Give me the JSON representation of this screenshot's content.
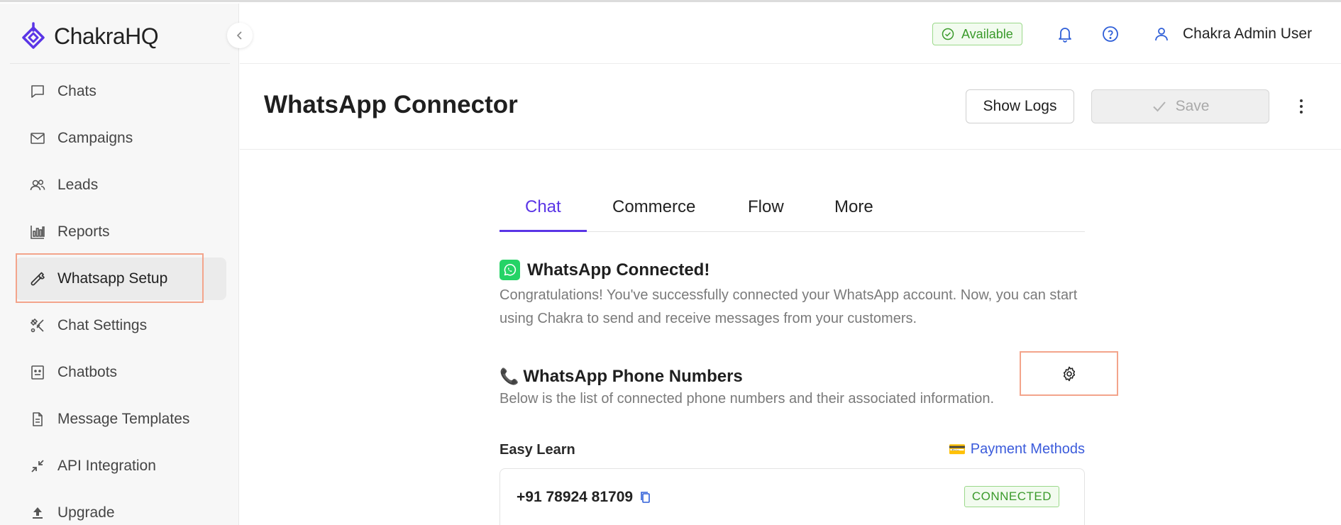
{
  "app": {
    "brand_name": "ChakraHQ",
    "accent_color": "#5a35e6"
  },
  "sidebar": {
    "items": [
      {
        "label": "Chats",
        "icon": "chat-bubble-icon"
      },
      {
        "label": "Campaigns",
        "icon": "mail-icon"
      },
      {
        "label": "Leads",
        "icon": "users-icon"
      },
      {
        "label": "Reports",
        "icon": "bar-chart-icon"
      },
      {
        "label": "Whatsapp Setup",
        "icon": "wrench-icon",
        "active": true
      },
      {
        "label": "Chat Settings",
        "icon": "tools-icon"
      },
      {
        "label": "Chatbots",
        "icon": "bot-icon"
      },
      {
        "label": "Message Templates",
        "icon": "document-icon"
      },
      {
        "label": "API Integration",
        "icon": "arrows-in-icon"
      },
      {
        "label": "Upgrade",
        "icon": "upload-icon"
      }
    ]
  },
  "header": {
    "status": "Available",
    "status_color": "#3a9a2b",
    "user_name": "Chakra Admin User"
  },
  "page": {
    "title": "WhatsApp Connector",
    "show_logs_label": "Show Logs",
    "save_label": "Save"
  },
  "tabs": [
    {
      "label": "Chat",
      "active": true
    },
    {
      "label": "Commerce"
    },
    {
      "label": "Flow"
    },
    {
      "label": "More"
    }
  ],
  "connected": {
    "title": "WhatsApp Connected!",
    "text": "Congratulations! You've successfully connected your WhatsApp account. Now, you can start using Chakra to send and receive messages from your customers."
  },
  "phones_section": {
    "emoji": "📞",
    "title": "WhatsApp Phone Numbers",
    "text": "Below is the list of connected phone numbers and their associated information."
  },
  "account": {
    "name": "Easy Learn",
    "payment_emoji": "💳",
    "payment_label": "Payment Methods",
    "phone_number": "+91 78924 81709",
    "phone_status": "CONNECTED"
  }
}
